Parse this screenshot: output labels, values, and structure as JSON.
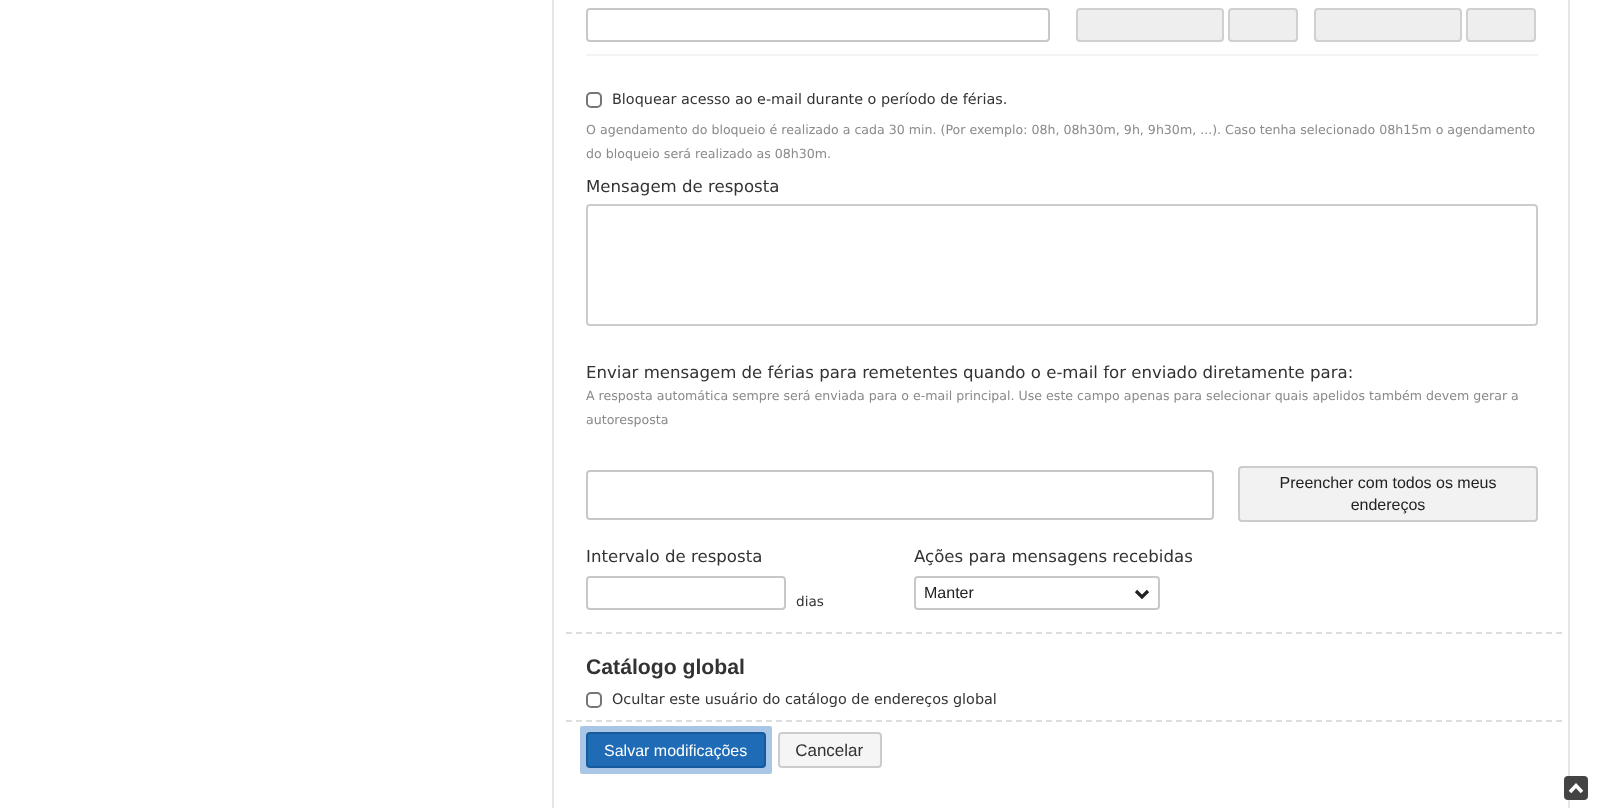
{
  "top_row": {
    "disabled_fields": [
      {
        "kind": "wide"
      },
      {
        "kind": "narrow"
      },
      {
        "kind": "wide"
      },
      {
        "kind": "narrow"
      }
    ]
  },
  "block_access": {
    "label": "Bloquear acesso ao e-mail durante o período de férias.",
    "checked": false
  },
  "block_hint": "O agendamento do bloqueio é realizado a cada 30 min. (Por exemplo: 08h, 08h30m, 9h, 9h30m, ...). Caso tenha selecionado 08h15m o agendamento do bloqueio será realizado as 08h30m.",
  "reply_message": {
    "label": "Mensagem de resposta"
  },
  "send_to": {
    "label": "Enviar mensagem de férias para remetentes quando o e-mail for enviado diretamente para:",
    "hint": "A resposta automática sempre será enviada para o e-mail principal. Use este campo apenas para selecionar quais apelidos também devem gerar a autoresposta",
    "fill_button": "Preencher com todos os meus endereços"
  },
  "interval": {
    "label": "Intervalo de resposta",
    "unit": "dias"
  },
  "actions": {
    "label": "Ações para mensagens recebidas",
    "value": "Manter"
  },
  "global_catalog": {
    "title": "Catálogo global",
    "option": {
      "label": "Ocultar este usuário do catálogo de endereços global",
      "checked": false
    }
  },
  "buttons": [
    {
      "label": "Salvar modificações",
      "kind": "primary",
      "focused": true
    },
    {
      "label": "Cancelar",
      "kind": "secondary",
      "focused": false
    }
  ]
}
